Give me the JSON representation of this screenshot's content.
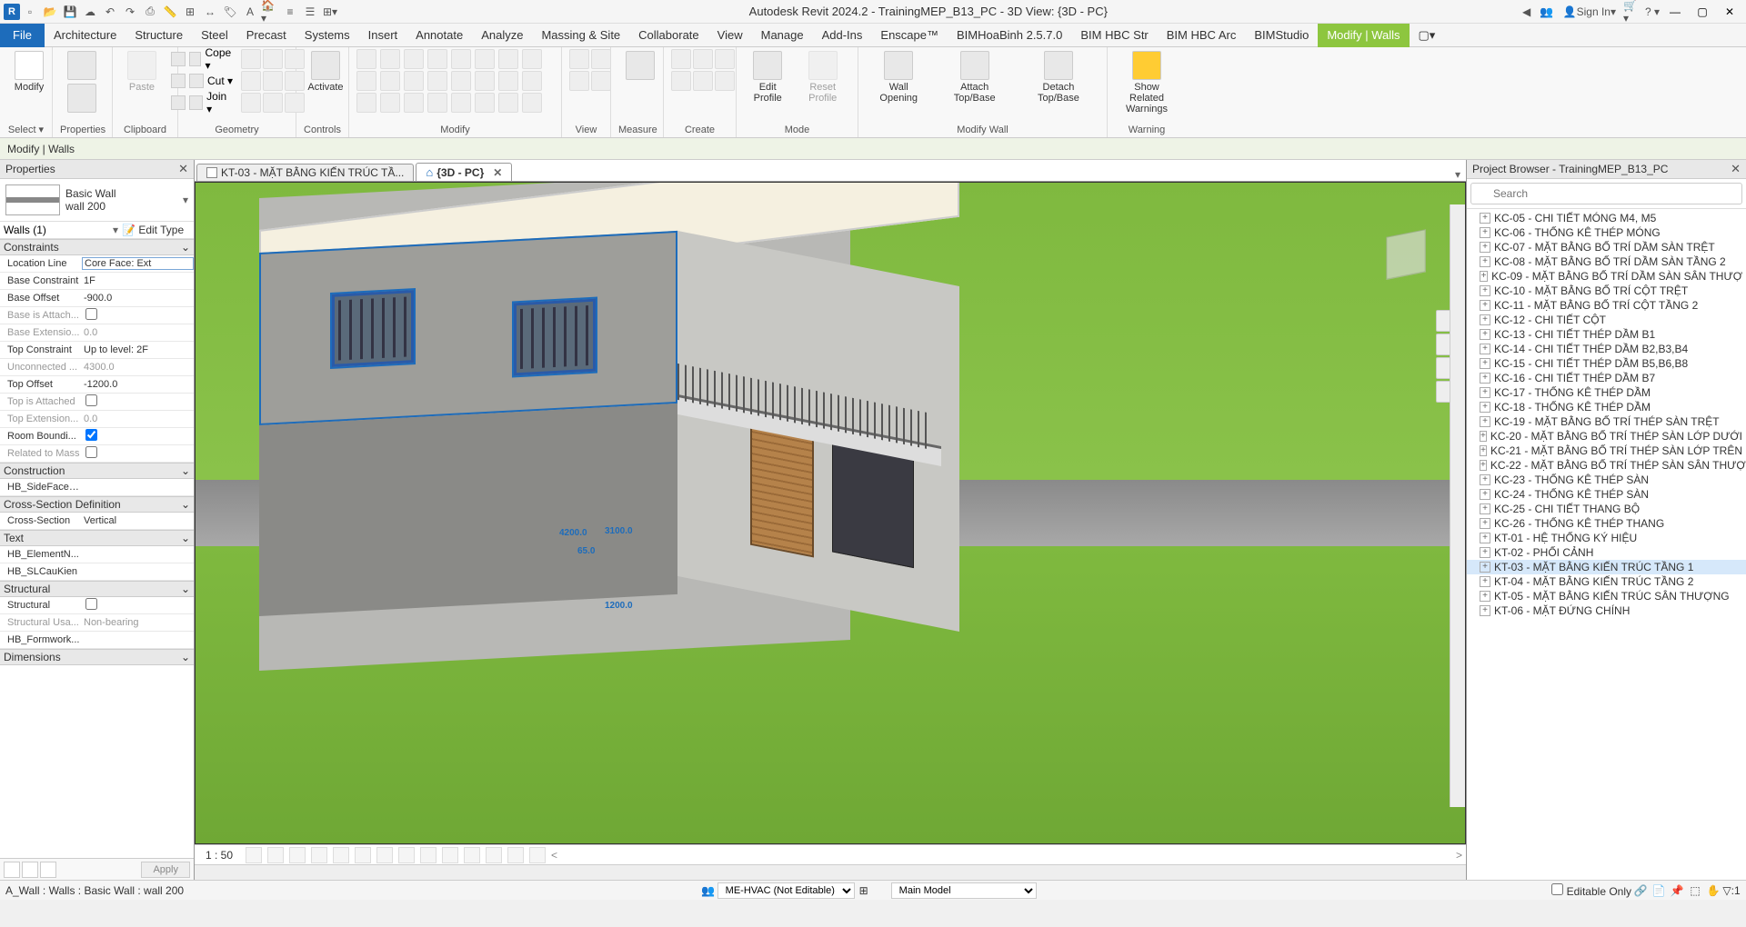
{
  "app_title": "Autodesk Revit 2024.2 - TrainingMEP_B13_PC - 3D View: {3D - PC}",
  "sign_in": "Sign In",
  "file_tab": "File",
  "menus": [
    "Architecture",
    "Structure",
    "Steel",
    "Precast",
    "Systems",
    "Insert",
    "Annotate",
    "Analyze",
    "Massing & Site",
    "Collaborate",
    "View",
    "Manage",
    "Add-Ins",
    "Enscape™",
    "BIMHoaBinh 2.5.7.0",
    "BIM HBC Str",
    "BIM HBC Arc",
    "BIMStudio"
  ],
  "active_menu": "Modify | Walls",
  "options_bar": "Modify | Walls",
  "ribbon_panels": {
    "select": {
      "label": "Select ▾",
      "items": [
        {
          "name": "Modify",
          "big": true
        }
      ]
    },
    "properties": {
      "label": "Properties",
      "items": [
        {
          "name": "",
          "big": true
        }
      ]
    },
    "clipboard": {
      "label": "Clipboard",
      "paste": "Paste",
      "small": [
        "Cope ▾",
        "Cut ▾",
        "Join ▾"
      ]
    },
    "geometry": {
      "label": "Geometry"
    },
    "activate": {
      "label": "Controls",
      "name": "Activate"
    },
    "modify": {
      "label": "Modify"
    },
    "view": {
      "label": "View"
    },
    "measure": {
      "label": "Measure"
    },
    "create": {
      "label": "Create"
    },
    "mode": {
      "label": "Mode",
      "items": [
        "Edit Profile",
        "Reset Profile"
      ]
    },
    "modify_wall": {
      "label": "Modify Wall",
      "items": [
        "Wall Opening",
        "Attach Top/Base",
        "Detach Top/Base"
      ]
    },
    "warning": {
      "label": "Warning",
      "items": [
        "Show Related\nWarnings"
      ]
    }
  },
  "properties": {
    "title": "Properties",
    "type_name": "Basic Wall",
    "type_sub": "wall 200",
    "category": "Walls (1)",
    "edit_type": "Edit Type",
    "groups": [
      {
        "name": "Constraints",
        "rows": [
          {
            "label": "Location Line",
            "value": "Core Face: Ext",
            "boxed": true
          },
          {
            "label": "Base Constraint",
            "value": "1F"
          },
          {
            "label": "Base Offset",
            "value": "-900.0"
          },
          {
            "label": "Base is Attach...",
            "value": "",
            "check": false,
            "dis": true
          },
          {
            "label": "Base Extensio...",
            "value": "0.0",
            "dis": true
          },
          {
            "label": "Top Constraint",
            "value": "Up to level: 2F"
          },
          {
            "label": "Unconnected ...",
            "value": "4300.0",
            "dis": true
          },
          {
            "label": "Top Offset",
            "value": "-1200.0"
          },
          {
            "label": "Top is Attached",
            "value": "",
            "check": false,
            "dis": true
          },
          {
            "label": "Top Extension...",
            "value": "0.0",
            "dis": true
          },
          {
            "label": "Room Boundi...",
            "value": "",
            "check": true
          },
          {
            "label": "Related to Mass",
            "value": "",
            "check": false,
            "dis": true
          }
        ]
      },
      {
        "name": "Construction",
        "rows": [
          {
            "label": "HB_SideFaceF...",
            "value": ""
          }
        ]
      },
      {
        "name": "Cross-Section Definition",
        "rows": [
          {
            "label": "Cross-Section",
            "value": "Vertical"
          }
        ]
      },
      {
        "name": "Text",
        "rows": [
          {
            "label": "HB_ElementN...",
            "value": ""
          },
          {
            "label": "HB_SLCauKien",
            "value": ""
          }
        ]
      },
      {
        "name": "Structural",
        "rows": [
          {
            "label": "Structural",
            "value": "",
            "check": false
          },
          {
            "label": "Structural Usa...",
            "value": "Non-bearing",
            "dis": true
          },
          {
            "label": "HB_Formwork...",
            "value": ""
          }
        ]
      },
      {
        "name": "Dimensions",
        "rows": []
      }
    ],
    "apply": "Apply"
  },
  "view_tabs": [
    {
      "name": "KT-03 - MẶT BẰNG KIẾN TRÚC TẦ...",
      "active": false,
      "icon": "doc"
    },
    {
      "name": "{3D - PC}",
      "active": true,
      "icon": "home",
      "closable": true
    }
  ],
  "dims": {
    "d1": "4200.0",
    "d2": "3100.0",
    "d3": "65.0",
    "d4": "1200.0"
  },
  "view_scale": "1 : 50",
  "project_browser": {
    "title": "Project Browser - TrainingMEP_B13_PC",
    "search_placeholder": "Search",
    "items": [
      "KC-05 - CHI TIẾT MÓNG M4, M5",
      "KC-06 - THỐNG KÊ THÉP MÓNG",
      "KC-07 - MẶT BẰNG BỐ TRÍ DẦM SÀN TRỆT",
      "KC-08 - MẶT BẰNG BỐ TRÍ DẦM SÀN TẦNG 2",
      "KC-09 - MẶT BẰNG BỐ TRÍ DẦM SÀN SÂN THƯỢ",
      "KC-10 - MẶT BẰNG BỐ TRÍ CỘT TRỆT",
      "KC-11 - MẶT BẰNG BỐ TRÍ CỘT TẦNG 2",
      "KC-12 - CHI TIẾT CỘT",
      "KC-13 - CHI TIẾT THÉP DẦM B1",
      "KC-14 - CHI TIẾT THÉP DẦM B2,B3,B4",
      "KC-15 - CHI TIẾT THÉP DẦM B5,B6,B8",
      "KC-16 - CHI TIẾT THÉP DẦM B7",
      "KC-17 - THỐNG KÊ THÉP DẦM",
      "KC-18 - THỐNG KÊ THÉP DẦM",
      "KC-19 - MẶT BẰNG BỐ TRÍ THÉP SÀN TRỆT",
      "KC-20 - MẶT BẰNG BỐ TRÍ THÉP SÀN LỚP DƯỚI",
      "KC-21 - MẶT BẰNG BỐ TRÍ THÉP SÀN LỚP TRÊN",
      "KC-22 - MẶT BẰNG BỐ TRÍ THÉP SÀN SÂN THƯỢ",
      "KC-23 - THỐNG KÊ THÉP SÀN",
      "KC-24 - THỐNG KÊ THÉP SÀN",
      "KC-25 - CHI TIẾT THANG BỘ",
      "KC-26 - THỐNG KÊ THÉP THANG",
      "KT-01 - HỆ THỐNG KÝ HIỆU",
      "KT-02 - PHỐI CẢNH",
      "KT-03 - MẶT BẰNG KIẾN TRÚC TẦNG 1",
      "KT-04 - MẶT BẰNG KIẾN TRÚC TẦNG 2",
      "KT-05 - MẶT BẰNG KIẾN TRÚC SÂN THƯỢNG",
      "KT-06 - MẶT ĐỨNG CHÍNH"
    ],
    "selected": "KT-03 - MẶT BẰNG KIẾN TRÚC TẦNG 1"
  },
  "statusbar": {
    "hint": "A_Wall : Walls : Basic Wall : wall 200",
    "workset": "ME-HVAC (Not Editable)",
    "model": "Main Model",
    "editable_only": "Editable Only",
    "filter_count": "1"
  }
}
